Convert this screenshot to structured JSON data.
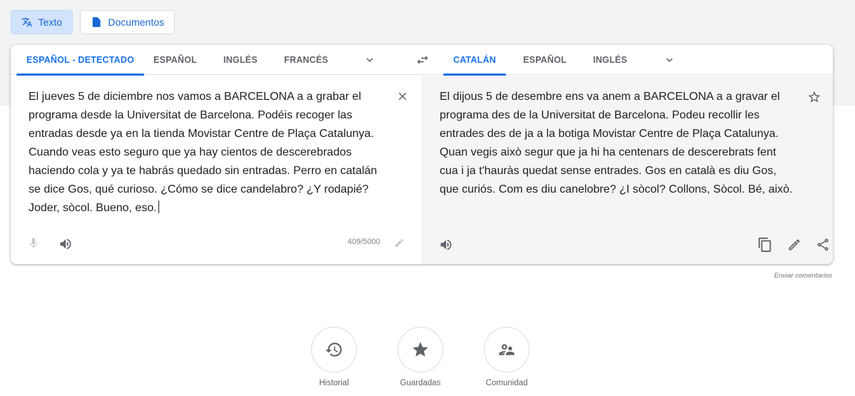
{
  "modes": {
    "text_label": "Texto",
    "docs_label": "Documentos"
  },
  "source": {
    "tabs": [
      "ESPAÑOL - DETECTADO",
      "ESPAÑOL",
      "INGLÉS",
      "FRANCÉS"
    ],
    "text": "El jueves 5 de diciembre nos vamos a BARCELONA a a grabar el programa desde la Universitat de Barcelona. Podéis recoger las entradas desde ya en la tienda Movistar Centre de Plaça Catalunya. Cuando veas esto seguro que ya hay cientos de descerebrados haciendo cola y ya te habrás quedado sin entradas. Perro en catalán se dice Gos, qué curioso. ¿Cómo se dice candelabro? ¿Y rodapié? Joder, sòcol. Bueno, eso.",
    "char_count": "409/5000"
  },
  "target": {
    "tabs": [
      "CATALÁN",
      "ESPAÑOL",
      "INGLÉS"
    ],
    "text": "El dijous 5 de desembre ens va anem a BARCELONA a a gravar el programa des de la Universitat de Barcelona. Podeu recollir les entrades des de ja a la botiga Movistar Centre de Plaça Catalunya. Quan vegis això segur que ja hi ha centenars de descerebrats fent cua i ja t'hauràs quedat sense entrades. Gos en català es diu Gos, que curiós. Com es diu canelobre? ¿I sòcol? Collons, Sòcol. Bé, això."
  },
  "feedback_label": "Enviar comentarios",
  "bottom": {
    "history": "Historial",
    "saved": "Guardadas",
    "community": "Comunidad"
  },
  "colors": {
    "accent": "#1a73e8",
    "active_mode_bg": "#d2e3fc",
    "target_bg": "#f5f5f5"
  }
}
